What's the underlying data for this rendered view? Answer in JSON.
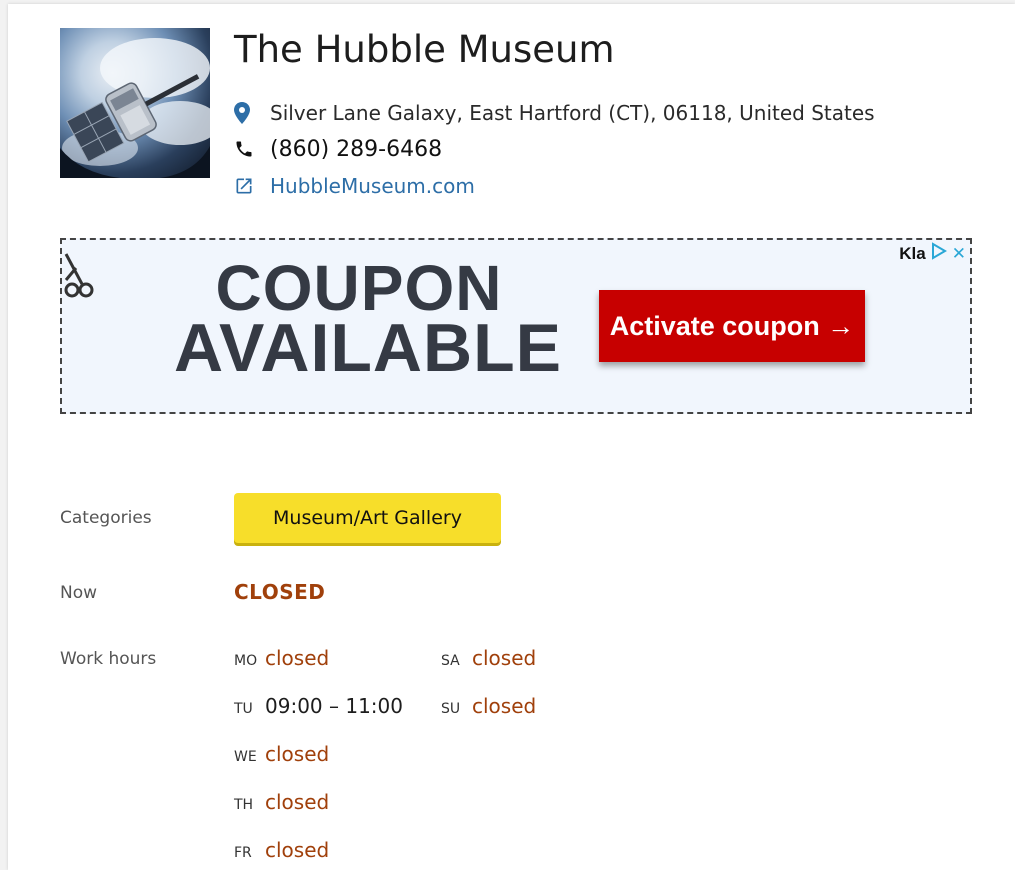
{
  "place": {
    "name": "The Hubble Museum",
    "address": "Silver Lane Galaxy, East Hartford (CT), 06118, United States",
    "phone": "(860) 289-6468",
    "website": "HubbleMuseum.com"
  },
  "ad": {
    "headline_line1": "COUPON",
    "headline_line2": "AVAILABLE",
    "cta_label": "Activate coupon →",
    "brand": "Kla",
    "close_glyph": "✕"
  },
  "details": {
    "categories_label": "Categories",
    "category": "Museum/Art Gallery",
    "now_label": "Now",
    "now_status": "CLOSED",
    "hours_label": "Work hours",
    "days": [
      {
        "abbr": "MO",
        "value": "closed"
      },
      {
        "abbr": "TU",
        "value": "09:00 – 11:00"
      },
      {
        "abbr": "WE",
        "value": "closed"
      },
      {
        "abbr": "TH",
        "value": "closed"
      },
      {
        "abbr": "FR",
        "value": "closed"
      },
      {
        "abbr": "SA",
        "value": "closed"
      },
      {
        "abbr": "SU",
        "value": "closed"
      }
    ]
  },
  "colors": {
    "closed": "#a0400b",
    "link": "#2d6ea7",
    "category_bg": "#f7de2a",
    "cta_bg": "#c70000"
  },
  "icons": [
    "location-pin-icon",
    "phone-icon",
    "external-link-icon",
    "scissors-icon",
    "ad-choices-icon",
    "close-icon"
  ]
}
